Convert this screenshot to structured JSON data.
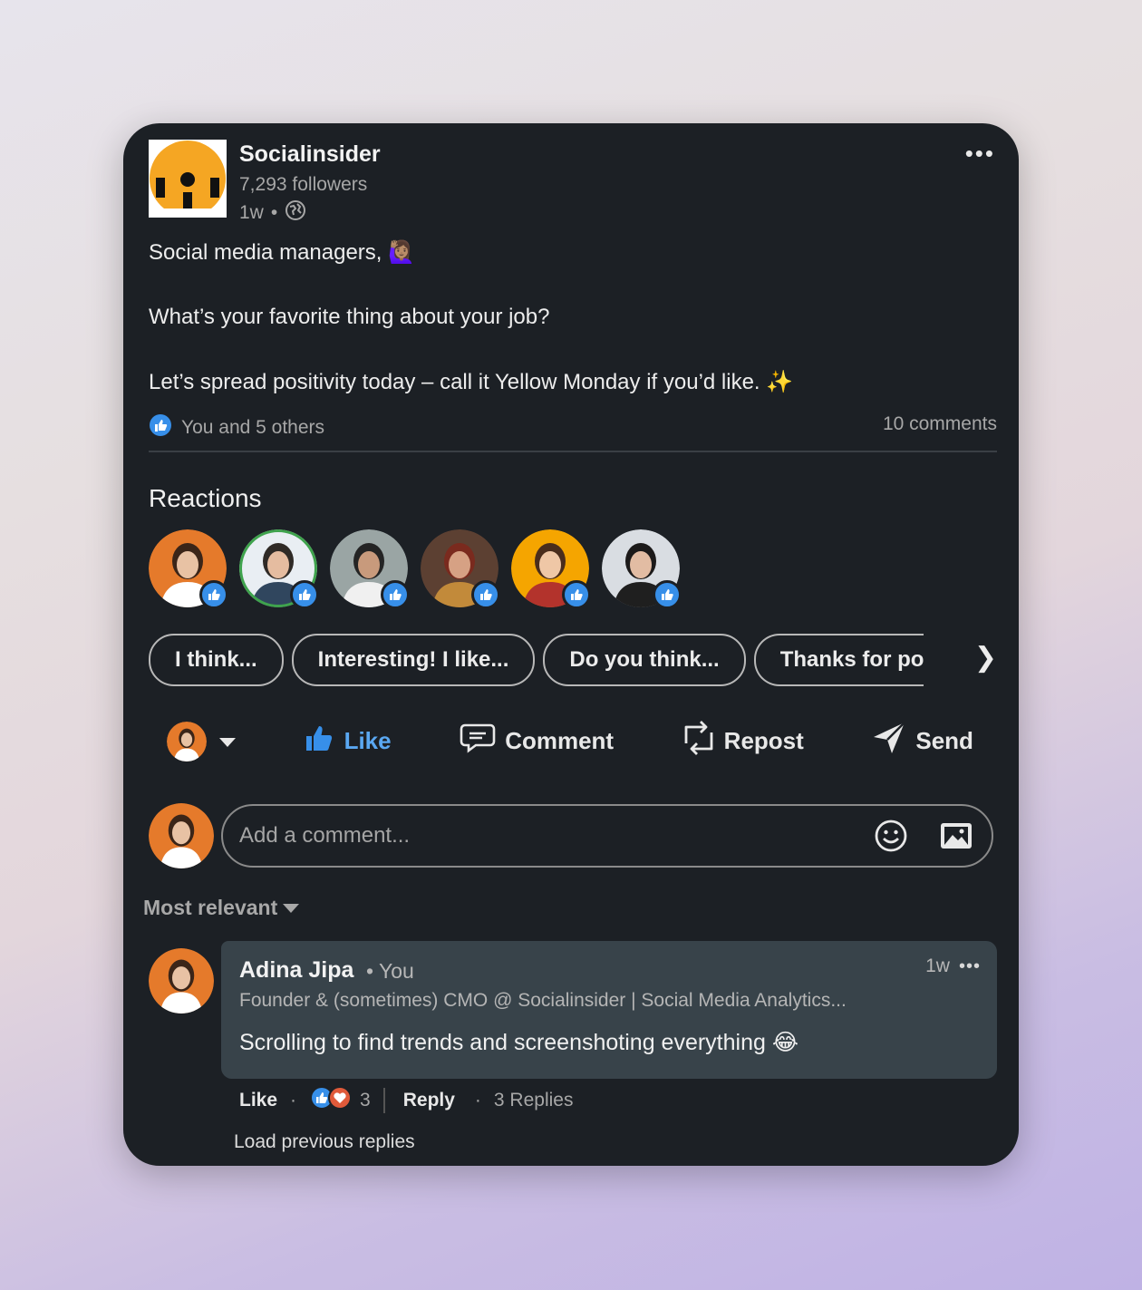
{
  "post": {
    "company": "Socialinsider",
    "followers": "7,293 followers",
    "age": "1w",
    "lines": [
      "Social media managers, 🙋🏽‍♀️",
      "What’s your favorite thing about your job?",
      "Let’s spread positivity today – call it Yellow Monday if you’d like. ✨"
    ],
    "reactions_summary": "You and 5 others",
    "comments_count": "10 comments"
  },
  "reactions": {
    "title": "Reactions",
    "people": [
      {
        "name": "reactor-1",
        "bg": "#e57a2b",
        "skin": "#e8c2a4",
        "hair": "#3b2518",
        "shirt": "#ffffff",
        "ring": ""
      },
      {
        "name": "reactor-2",
        "bg": "#e9eef3",
        "skin": "#e5bca0",
        "hair": "#2f2a26",
        "shirt": "#30465e",
        "ring": "#3fa34d"
      },
      {
        "name": "reactor-3",
        "bg": "#9aa5a4",
        "skin": "#c89a7c",
        "hair": "#242424",
        "shirt": "#f0f0f0",
        "ring": ""
      },
      {
        "name": "reactor-4",
        "bg": "#5c4032",
        "skin": "#d6a184",
        "hair": "#7a2a1e",
        "shirt": "#c28a3a",
        "ring": ""
      },
      {
        "name": "reactor-5",
        "bg": "#f5a500",
        "skin": "#efc7a6",
        "hair": "#4a2d1c",
        "shirt": "#b3332c",
        "ring": ""
      },
      {
        "name": "reactor-6",
        "bg": "#d9dde2",
        "skin": "#e2bca3",
        "hair": "#1c1a1a",
        "shirt": "#1f1f1f",
        "ring": ""
      }
    ]
  },
  "suggestions": [
    "I think...",
    "Interesting! I like...",
    "Do you think...",
    "Thanks for po"
  ],
  "actions": {
    "like": "Like",
    "comment": "Comment",
    "repost": "Repost",
    "send": "Send"
  },
  "composer": {
    "placeholder": "Add a comment..."
  },
  "sort": {
    "label": "Most relevant"
  },
  "comment": {
    "author": "Adina Jipa",
    "relation": "• You",
    "time": "1w",
    "headline": "Founder & (sometimes) CMO @ Socialinsider | Social Media Analytics...",
    "text": "Scrolling to find trends and screenshoting everything 😂",
    "like": "Like",
    "reaction_count": "3",
    "reply": "Reply",
    "replies": "3 Replies",
    "load_previous": "Load previous replies"
  },
  "colors": {
    "accent": "#378fe9",
    "card": "#1c2025",
    "bubble": "#38434a",
    "logo": "#f5a623"
  }
}
